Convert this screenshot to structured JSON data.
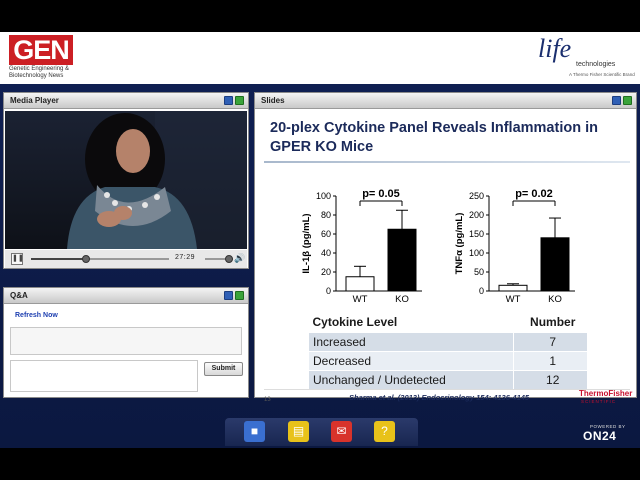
{
  "header": {
    "gen_logo": "GEN",
    "gen_subtitle": "Genetic Engineering & Biotechnology News",
    "life_logo": "life",
    "life_sub": "technologies",
    "life_tagline": "A Thermo Fisher Scientific Brand"
  },
  "media_player": {
    "title": "Media Player",
    "time": "27:29",
    "progress_fraction": 0.4,
    "volume_fraction": 0.85
  },
  "qa": {
    "title": "Q&A",
    "refresh_label": "Refresh Now",
    "input_value": "",
    "submit_label": "Submit"
  },
  "slides": {
    "title": "Slides",
    "slide_title": "20-plex Cytokine Panel Reveals Inflammation in GPER KO Mice",
    "table": {
      "headers": [
        "Cytokine Level",
        "Number"
      ],
      "rows": [
        {
          "label": "Increased",
          "value": "7"
        },
        {
          "label": "Decreased",
          "value": "1"
        },
        {
          "label": "Unchanged / Undetected",
          "value": "12"
        }
      ]
    },
    "slide_number": "13",
    "citation": "Sharma et al. (2013) Endocrinology 154: 4136-4145",
    "logo": "ThermoFisher",
    "logo_sub": "SCIENTIFIC"
  },
  "chart_data": [
    {
      "type": "bar",
      "categories": [
        "WT",
        "KO"
      ],
      "values": [
        15,
        65
      ],
      "errors": [
        11,
        20
      ],
      "colors": [
        "#ffffff",
        "#000000"
      ],
      "ylabel": "IL-1β (pg/mL)",
      "ylim": [
        0,
        100
      ],
      "yticks": [
        0,
        20,
        40,
        60,
        80,
        100
      ],
      "annotation": "p= 0.05"
    },
    {
      "type": "bar",
      "categories": [
        "WT",
        "KO"
      ],
      "values": [
        15,
        140
      ],
      "errors": [
        4,
        52
      ],
      "colors": [
        "#ffffff",
        "#000000"
      ],
      "ylabel": "TNFα (pg/mL)",
      "ylim": [
        0,
        250
      ],
      "yticks": [
        0,
        50,
        100,
        150,
        200,
        250
      ],
      "annotation": "p= 0.02"
    }
  ],
  "toolbar": {
    "buttons": [
      {
        "name": "media-player-button",
        "icon": "camera-icon",
        "color": "#3a6fd0"
      },
      {
        "name": "slides-button",
        "icon": "slides-icon",
        "color": "#e8c21a"
      },
      {
        "name": "qa-button",
        "icon": "chat-icon",
        "color": "#d8332b"
      },
      {
        "name": "help-button",
        "icon": "question-icon",
        "color": "#e8c21a"
      }
    ]
  },
  "branding": {
    "powered_by": "POWERED BY",
    "on24": "ON24"
  }
}
